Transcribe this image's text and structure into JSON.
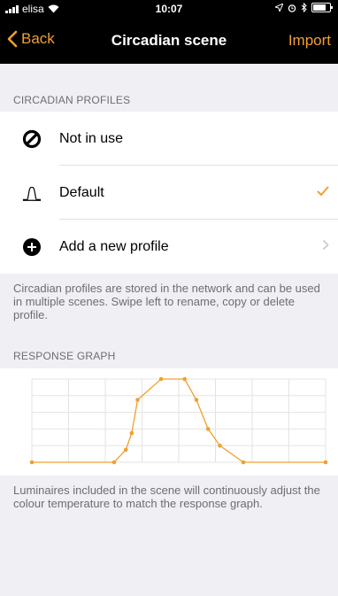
{
  "status_bar": {
    "carrier": "elisa",
    "time": "10:07"
  },
  "nav": {
    "back_label": "Back",
    "title": "Circadian scene",
    "import_label": "Import"
  },
  "profiles_section": {
    "header": "CIRCADIAN PROFILES",
    "items": [
      {
        "label": "Not in use",
        "icon": "prohibited-icon",
        "accessory": ""
      },
      {
        "label": "Default",
        "icon": "curve-icon",
        "accessory": "checkmark"
      },
      {
        "label": "Add a new profile",
        "icon": "plus-circle-icon",
        "accessory": "chevron"
      }
    ],
    "footer": "Circadian profiles are stored in the network and can be used in multiple scenes. Swipe left to rename, copy or delete profile."
  },
  "graph_section": {
    "header": "RESPONSE GRAPH",
    "footer": "Luminaires included in the scene will continuously adjust the colour temperature to match the response graph."
  },
  "colors": {
    "accent": "#f0a030",
    "background": "#efeff4",
    "navbar": "#000000",
    "secondary_text": "#6d6d72"
  },
  "chart_data": {
    "type": "line",
    "x": [
      0,
      7,
      8,
      8.5,
      9,
      11,
      13,
      14,
      15,
      16,
      18,
      25
    ],
    "y": [
      0,
      0,
      0.15,
      0.35,
      0.75,
      1,
      1,
      0.75,
      0.4,
      0.2,
      0,
      0
    ],
    "xlim": [
      0,
      25
    ],
    "ylim": [
      0,
      1
    ],
    "grid": true
  }
}
